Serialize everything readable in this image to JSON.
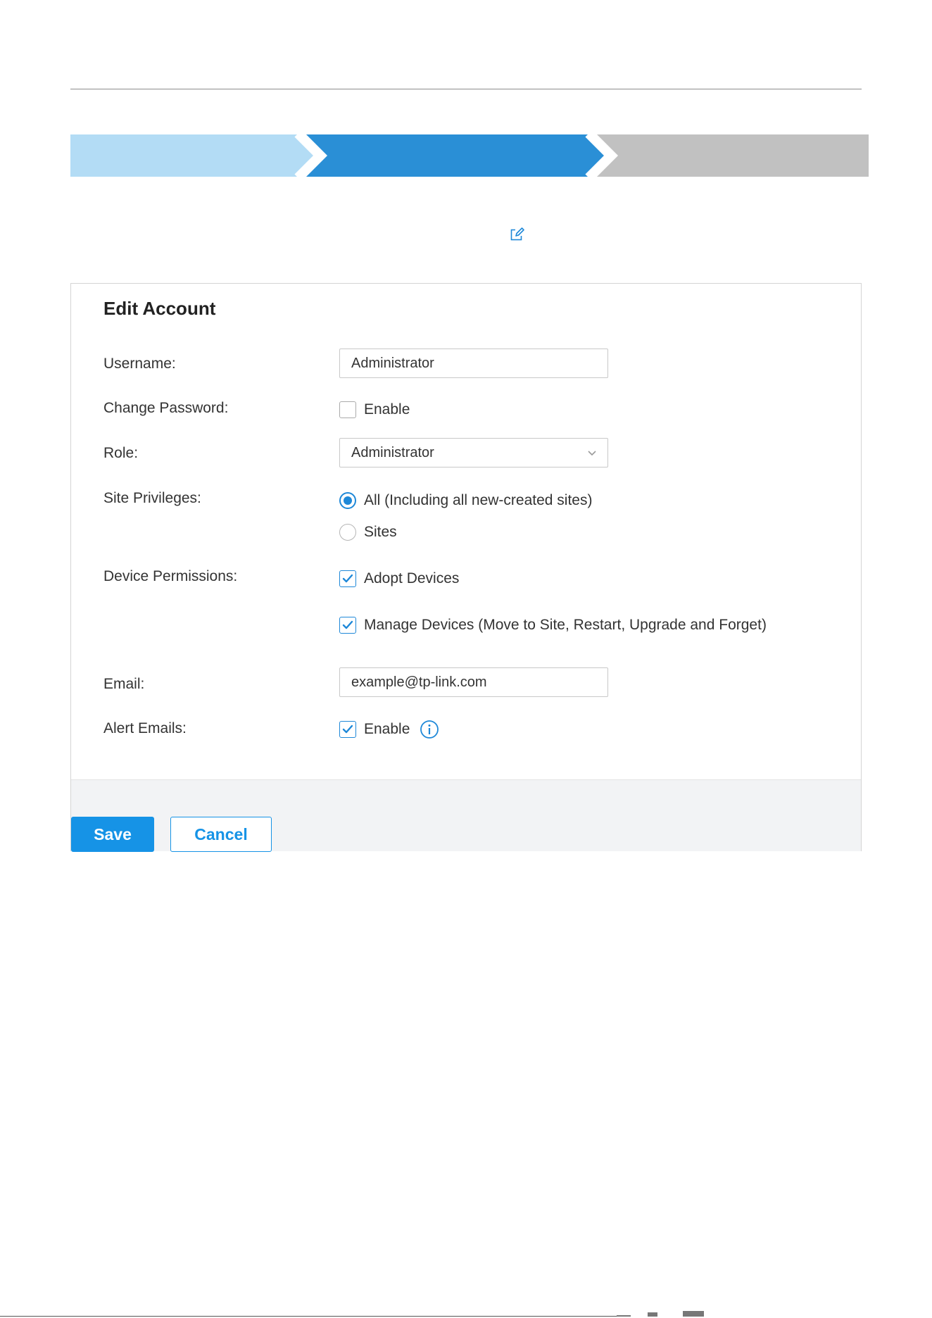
{
  "wizard": {
    "steps": [
      {
        "state": "done",
        "color": "#b3dcf5"
      },
      {
        "state": "current",
        "color": "#2a8fd6"
      },
      {
        "state": "pending",
        "color": "#c1c1c1"
      }
    ]
  },
  "edit_icon": {
    "name": "edit-icon",
    "color": "#1e88d8"
  },
  "form": {
    "title": "Edit Account",
    "username": {
      "label": "Username:",
      "value": "Administrator"
    },
    "change_password": {
      "label": "Change Password:",
      "option": "Enable",
      "checked": false
    },
    "role": {
      "label": "Role:",
      "selected": "Administrator"
    },
    "site_privileges": {
      "label": "Site Privileges:",
      "options": [
        {
          "label": "All (Including all new-created sites)",
          "selected": true
        },
        {
          "label": "Sites",
          "selected": false
        }
      ]
    },
    "device_permissions": {
      "label": "Device Permissions:",
      "options": [
        {
          "label": "Adopt Devices",
          "checked": true
        },
        {
          "label": "Manage Devices (Move to Site, Restart, Upgrade and Forget)",
          "checked": true
        }
      ]
    },
    "email": {
      "label": "Email:",
      "value": "example@tp-link.com"
    },
    "alert_emails": {
      "label": "Alert Emails:",
      "option": "Enable",
      "checked": true,
      "icon": "info-icon"
    }
  },
  "actions": {
    "save_label": "Save",
    "cancel_label": "Cancel"
  },
  "colors": {
    "accent": "#1693e6",
    "checkbox": "#1e88d8"
  }
}
